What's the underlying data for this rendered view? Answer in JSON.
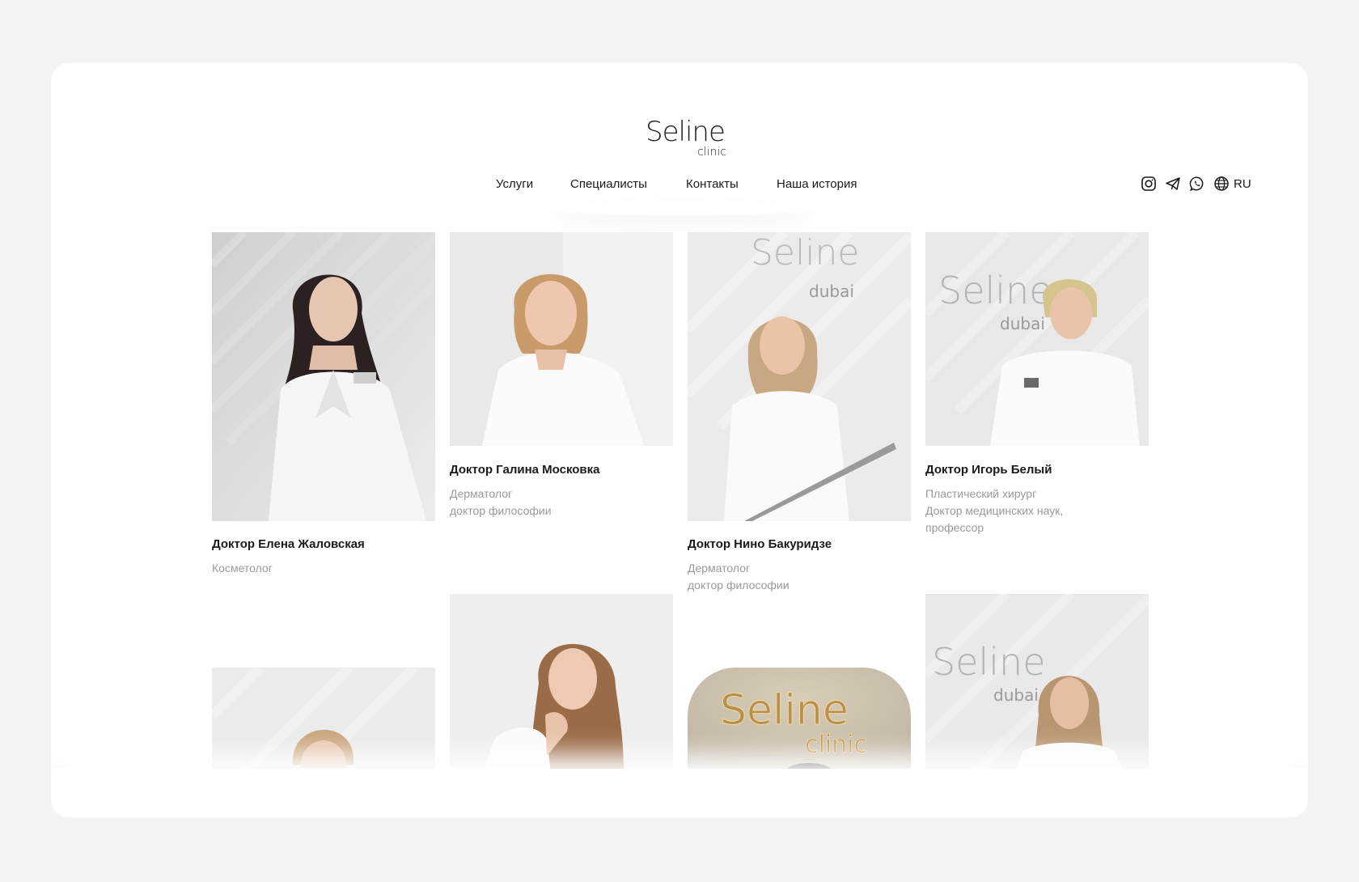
{
  "brand": {
    "logo_main": "Seline",
    "logo_sub": "clinic"
  },
  "nav": {
    "items": [
      "Услуги",
      "Специалисты",
      "Контакты",
      "Наша история"
    ]
  },
  "header_icons": [
    "instagram-icon",
    "telegram-icon",
    "whatsapp-icon",
    "globe-icon"
  ],
  "language": "RU",
  "doctors": [
    {
      "name": "Доктор Елена Жаловская",
      "roles": [
        "Косметолог"
      ]
    },
    {
      "name": "Доктор Галина Московка",
      "roles": [
        "Дерматолог",
        "доктор философии"
      ]
    },
    {
      "name": "Доктор Нино Бакуридзе",
      "roles": [
        "Дерматолог",
        "доктор философии"
      ]
    },
    {
      "name": "Доктор Игорь Белый",
      "roles": [
        "Пластический хирург",
        "Доктор медицинских наук,",
        "профессор"
      ]
    }
  ],
  "wall_signs": {
    "dubai_main": "Seline",
    "dubai_sub": "dubai",
    "clinic_main": "Seline",
    "clinic_sub": "clinic"
  },
  "colors": {
    "background": "#f4f4f4",
    "panel": "#ffffff",
    "text": "#1a1a1a",
    "muted": "#9a9a9a"
  }
}
